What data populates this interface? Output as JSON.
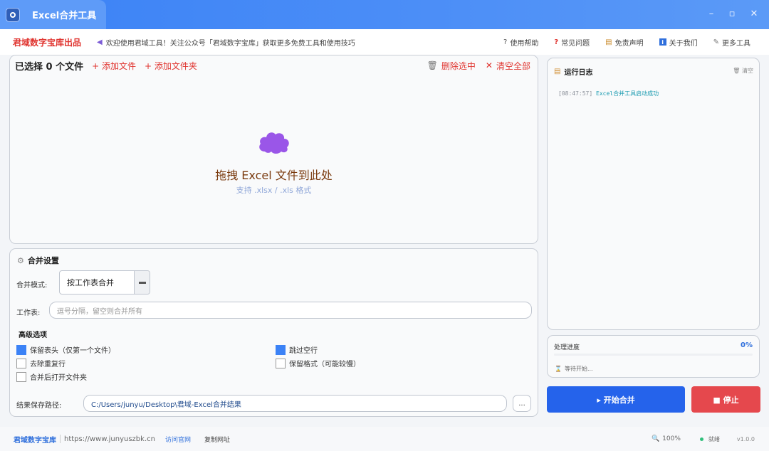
{
  "window": {
    "title": "Excel合并工具",
    "controls": {
      "minimize": "–",
      "maximize": "▫",
      "close": "✕"
    }
  },
  "header": {
    "brand": "君域数字宝库出品",
    "notice": "欢迎使用君域工具！关注公众号「君域数字宝库」获取更多免费工具和使用技巧",
    "links": [
      {
        "icon": "?",
        "label": "使用帮助"
      },
      {
        "icon": "?",
        "label": "常见问题"
      },
      {
        "icon": "▤",
        "label": "免责声明"
      },
      {
        "icon": "i",
        "label": "关于我们"
      },
      {
        "icon": "✎",
        "label": "更多工具"
      }
    ]
  },
  "files": {
    "count_label": "已选择 0 个文件",
    "add_file": "+ 添加文件",
    "add_folder": "+ 添加文件夹",
    "delete_selected": "删除选中",
    "clear_all": "清空全部",
    "drop_title": "拖拽 Excel 文件到此处",
    "drop_sub": "支持 .xlsx / .xls 格式"
  },
  "settings": {
    "title": "合并设置",
    "mode_label": "合并模式:",
    "mode_value": "按工作表合并",
    "sheet_label": "工作表:",
    "sheet_placeholder": "逗号分隔，留空则合并所有",
    "advanced_title": "高级选项",
    "options": [
      {
        "label": "保留表头（仅第一个文件）",
        "checked": true
      },
      {
        "label": "跳过空行",
        "checked": true
      },
      {
        "label": "去除重复行",
        "checked": false
      },
      {
        "label": "保留格式（可能较慢）",
        "checked": false
      },
      {
        "label": "合并后打开文件夹",
        "checked": false
      }
    ],
    "path_label": "结果保存路径:",
    "path_value": "C:/Users/junyu/Desktop\\君域-Excel合并结果",
    "browse": "..."
  },
  "log": {
    "title": "运行日志",
    "clear": "清空",
    "entries": [
      {
        "time": "[08:47:57]",
        "message": "Excel合并工具启动成功"
      }
    ]
  },
  "progress": {
    "label": "处理进度",
    "percent_text": "0%",
    "value": 0,
    "status": "等待开始..."
  },
  "actions": {
    "start": "▸ 开始合并",
    "stop": "■ 停止"
  },
  "footer": {
    "brand": "君域数字宝库",
    "url": "https://www.junyuszbk.cn",
    "visit": "访问官网",
    "copy": "复制网址",
    "zoom": "100%",
    "status": "就绪",
    "version": "v1.0.0"
  },
  "colors": {
    "accent": "#3b82f6",
    "brand_red": "#e0342f",
    "start_button": "#2563eb",
    "stop_button": "#e5484d"
  }
}
